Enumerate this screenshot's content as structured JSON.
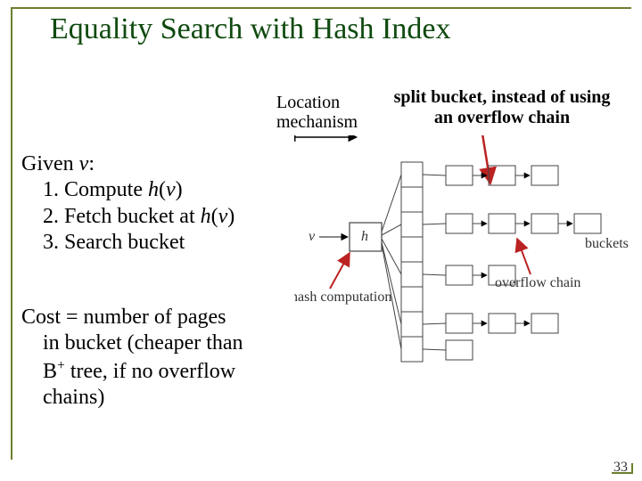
{
  "title": "Equality Search with Hash Index",
  "loc_mech_l1": "Location",
  "loc_mech_l2": "mechanism",
  "split_note": "split bucket, instead of using an overflow chain",
  "given": {
    "given_label": "Given ",
    "v": "v",
    "colon": ":",
    "step1_a": "1. Compute ",
    "step1_h": "h",
    "step1_p1": "(",
    "step1_v": "v",
    "step1_p2": ")",
    "step2_a": "2. Fetch bucket at ",
    "step2_h": "h",
    "step2_p1": "(",
    "step2_v": "v",
    "step2_p2": ")",
    "step3": "3. Search bucket"
  },
  "cost": {
    "l1": "Cost = number of pages",
    "l2a": "in bucket (cheaper than",
    "l3a": "B",
    "l3plus": "+",
    "l3b": " tree, if no overflow",
    "l4": "chains)"
  },
  "diagram": {
    "v": "v",
    "h": "h",
    "hash_comp": "hash computation",
    "overflow_chain": "overflow chain",
    "buckets": "buckets"
  },
  "slide_num": "33"
}
